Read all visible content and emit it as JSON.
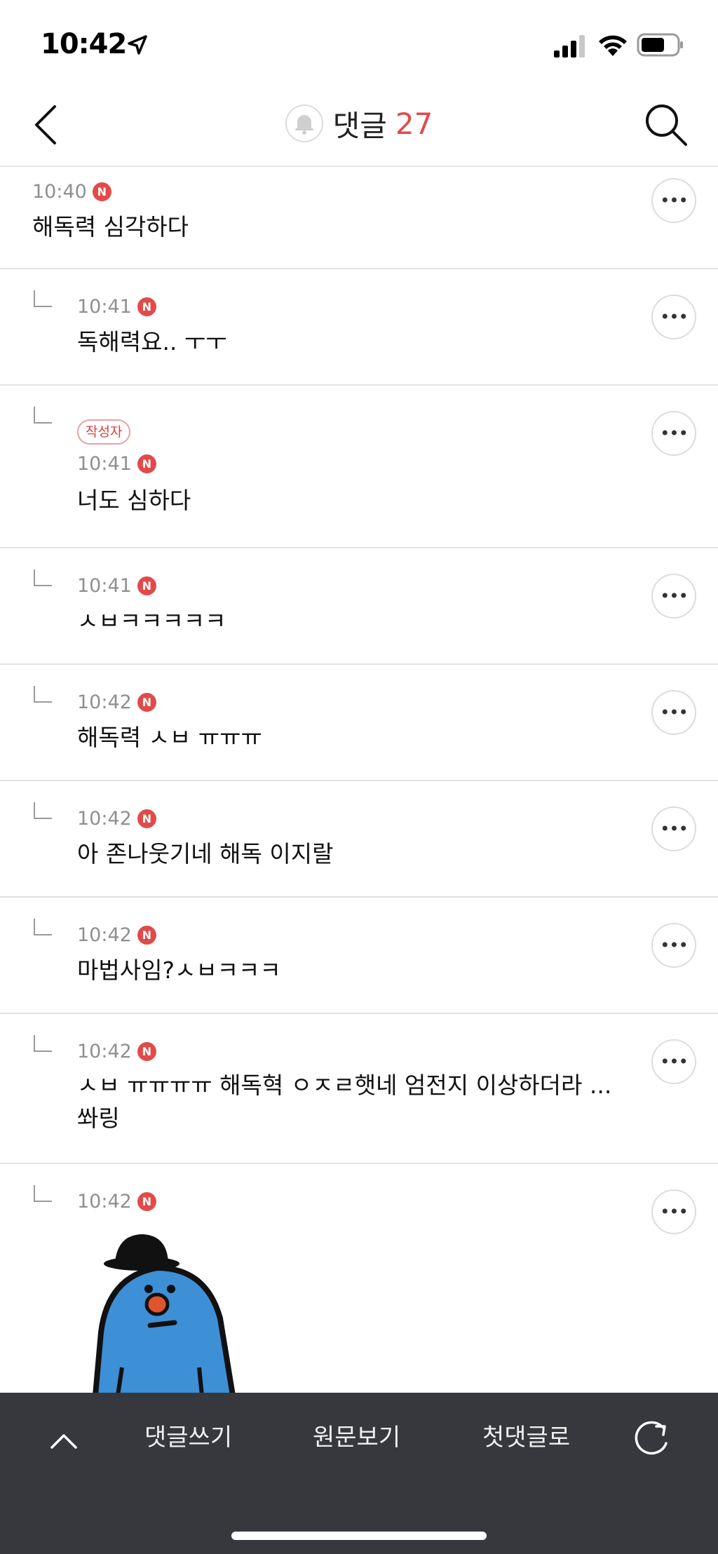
{
  "status_bar": {
    "time": "10:42"
  },
  "nav": {
    "title": "댓글",
    "count": "27"
  },
  "comments": [
    {
      "time": "10:40",
      "new_badge": "N",
      "text": "해독력 심각하다"
    },
    {
      "time": "10:41",
      "new_badge": "N",
      "text": "독해력요.. ㅜㅜ"
    },
    {
      "author_badge": "작성자",
      "time": "10:41",
      "new_badge": "N",
      "text": "너도 심하다"
    },
    {
      "time": "10:41",
      "new_badge": "N",
      "text": "ㅅㅂㅋㅋㅋㅋㅋ"
    },
    {
      "time": "10:42",
      "new_badge": "N",
      "text": "해독력 ㅅㅂ ㅠㅠㅠ"
    },
    {
      "time": "10:42",
      "new_badge": "N",
      "text": "아 존나웃기네 해독 이지랄"
    },
    {
      "time": "10:42",
      "new_badge": "N",
      "text": "마법사임?ㅅㅂㅋㅋㅋ"
    },
    {
      "time": "10:42",
      "new_badge": "N",
      "text": "ㅅㅂ ㅠㅠㅠㅠ 해독혁 ㅇㅈㄹ햇네 엄전지 이상하더라 ... 쏴링"
    },
    {
      "time": "10:42",
      "new_badge": "N"
    }
  ],
  "bottom_bar": {
    "write_comment": "댓글쓰기",
    "view_original": "원문보기",
    "first_comment": "첫댓글로"
  },
  "colors": {
    "accent": "#e24a4a",
    "bottom_bar": "#37383d"
  }
}
